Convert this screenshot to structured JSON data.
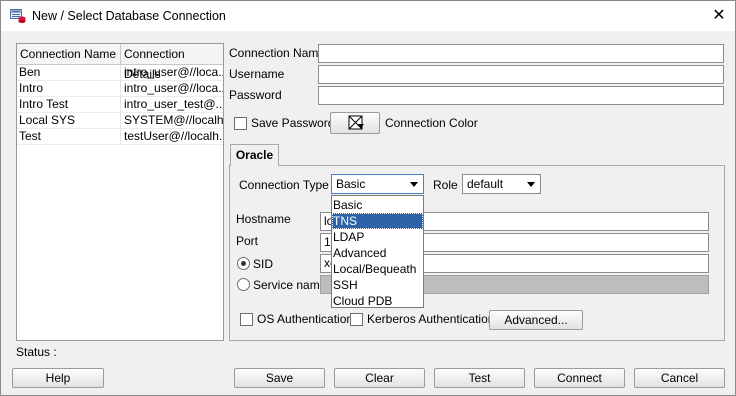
{
  "window": {
    "title": "New / Select Database Connection",
    "icon": "database-connection-icon",
    "close_glyph": "✕"
  },
  "connections": {
    "headers": [
      "Connection Name",
      "Connection Details"
    ],
    "rows": [
      {
        "name": "Ben",
        "details": "intro_user@//loca..."
      },
      {
        "name": "Intro",
        "details": "intro_user@//loca..."
      },
      {
        "name": "Intro Test",
        "details": "intro_user_test@..."
      },
      {
        "name": "Local SYS",
        "details": "SYSTEM@//localh..."
      },
      {
        "name": "Test",
        "details": "testUser@//localh..."
      }
    ]
  },
  "form": {
    "connection_name_label": "Connection Name",
    "connection_name_value": "",
    "username_label": "Username",
    "username_value": "",
    "password_label": "Password",
    "password_value": "",
    "save_password_label": "Save Password",
    "save_password_checked": false,
    "connection_color_label": "Connection Color"
  },
  "oracle": {
    "tab_label": "Oracle",
    "connection_type_label": "Connection Type",
    "connection_type_value": "Basic",
    "role_label": "Role",
    "role_value": "default",
    "hostname_label": "Hostname",
    "hostname_value": "lo",
    "port_label": "Port",
    "port_value": "15",
    "sid_label": "SID",
    "sid_value": "xe",
    "service_name_label": "Service name",
    "service_name_value": "",
    "sid_selected": true,
    "os_auth_label": "OS Authentication",
    "kerberos_auth_label": "Kerberos Authentication",
    "advanced_button": "Advanced..."
  },
  "dropdown": {
    "options": [
      "Basic",
      "TNS",
      "LDAP",
      "Advanced",
      "Local/Bequeath",
      "SSH",
      "Cloud PDB"
    ],
    "highlighted": "TNS",
    "highlight_color": "#2f63a8"
  },
  "status": {
    "label": "Status :"
  },
  "buttons": {
    "help": "Help",
    "save": "Save",
    "clear": "Clear",
    "test": "Test",
    "connect": "Connect",
    "cancel": "Cancel"
  }
}
